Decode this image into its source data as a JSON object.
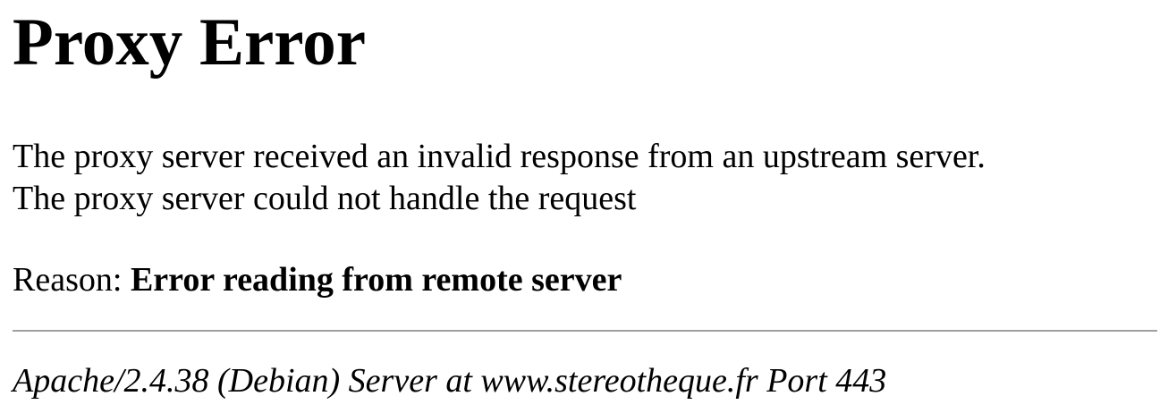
{
  "page": {
    "title": "Proxy Error",
    "message_line1": "The proxy server received an invalid response from an upstream server.",
    "message_line2": "The proxy server could not handle the request",
    "reason_label": "Reason: ",
    "reason_text": "Error reading from remote server",
    "server_signature": "Apache/2.4.38 (Debian) Server at www.stereotheque.fr Port 443"
  },
  "colors": {
    "text": "#000000",
    "background": "#ffffff",
    "rule": "#a0a0a0"
  }
}
